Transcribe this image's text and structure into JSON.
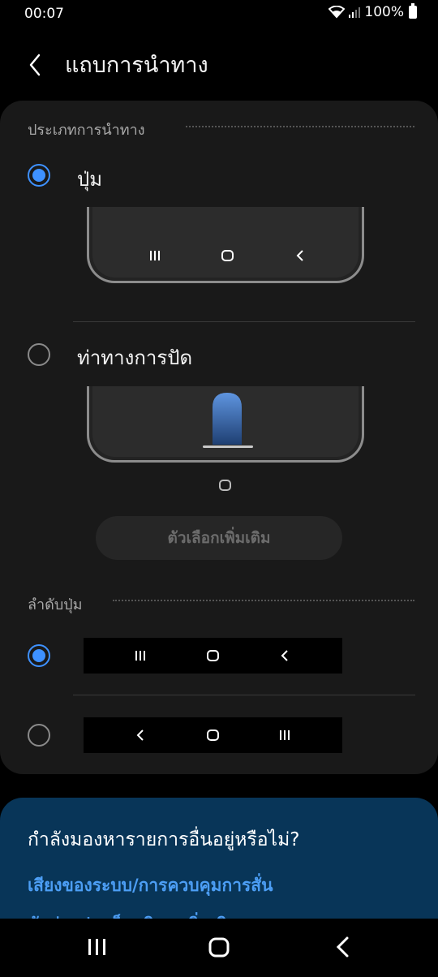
{
  "status_bar": {
    "time": "00:07",
    "battery": "100%"
  },
  "header": {
    "title": "แถบการนำทาง"
  },
  "navigation_type": {
    "section_title": "ประเภทการนำทาง",
    "options": [
      {
        "label": "ปุ่ม",
        "selected": true
      },
      {
        "label": "ท่าทางการปัด",
        "selected": false
      }
    ],
    "more_options_label": "ตัวเลือกเพิ่มเติม"
  },
  "button_order": {
    "section_title": "ลำดับปุ่ม",
    "options": [
      {
        "order": [
          "recents",
          "home",
          "back"
        ],
        "selected": true
      },
      {
        "order": [
          "back",
          "home",
          "recents"
        ],
        "selected": false
      }
    ]
  },
  "suggestions": {
    "title": "กำลังมองหารายการอื่นอยู่หรือไม่?",
    "links": [
      "เสียงของระบบ/การควบคุมการสั่น",
      "ตัวช่วยปลดล็อกพิเศษเพิ่มเติม"
    ]
  },
  "colors": {
    "accent": "#3e91ff",
    "link": "#4c9ef5",
    "suggest_bg": "#083558"
  }
}
